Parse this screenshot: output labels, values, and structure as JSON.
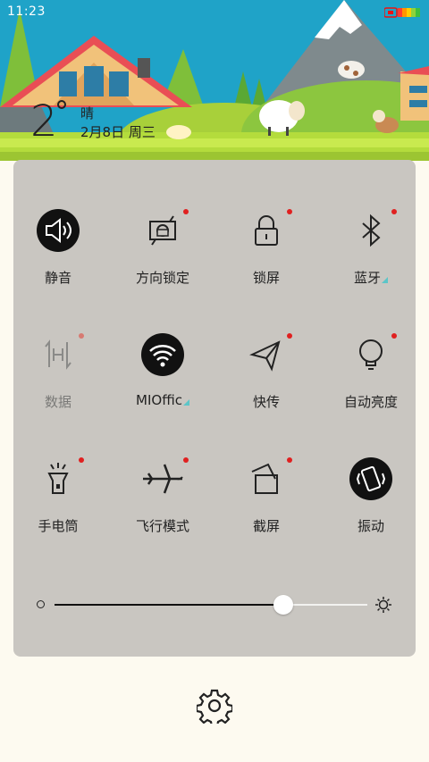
{
  "status_bar": {
    "time": "11:23"
  },
  "weather": {
    "temperature": "2",
    "condition": "晴",
    "date": "2月8日 周三"
  },
  "toggles": [
    {
      "id": "mute",
      "label": "静音",
      "icon": "speaker-icon",
      "active": true,
      "dot": false
    },
    {
      "id": "rotation-lock",
      "label": "方向锁定",
      "icon": "rotation-lock-icon",
      "active": false,
      "dot": true
    },
    {
      "id": "lock-screen",
      "label": "锁屏",
      "icon": "padlock-icon",
      "active": false,
      "dot": true
    },
    {
      "id": "bluetooth",
      "label": "蓝牙",
      "icon": "bluetooth-icon",
      "active": false,
      "dot": true,
      "more": true
    },
    {
      "id": "data",
      "label": "数据",
      "icon": "mobile-data-icon",
      "active": false,
      "dot": true,
      "disabled": true
    },
    {
      "id": "wifi",
      "label": "MIOffic",
      "icon": "wifi-icon",
      "active": true,
      "dot": false,
      "more": true
    },
    {
      "id": "quick-send",
      "label": "快传",
      "icon": "paper-plane-icon",
      "active": false,
      "dot": true
    },
    {
      "id": "auto-brightness",
      "label": "自动亮度",
      "icon": "light-bulb-icon",
      "active": false,
      "dot": true
    },
    {
      "id": "flashlight",
      "label": "手电筒",
      "icon": "flashlight-icon",
      "active": false,
      "dot": true
    },
    {
      "id": "airplane",
      "label": "飞行模式",
      "icon": "airplane-icon",
      "active": false,
      "dot": true
    },
    {
      "id": "screenshot",
      "label": "截屏",
      "icon": "screenshot-icon",
      "active": false,
      "dot": true
    },
    {
      "id": "vibrate",
      "label": "振动",
      "icon": "vibrate-icon",
      "active": true,
      "dot": false
    }
  ],
  "brightness": {
    "level": 0.73,
    "min_icon": "brightness-low-icon",
    "max_icon": "brightness-high-icon"
  },
  "footer": {
    "settings_icon": "gear-icon"
  },
  "colors": {
    "panel": "#c9c6c1",
    "page": "#fdfaf0",
    "accent_dot": "#e02020",
    "more_triangle": "#5cc5c8",
    "sky": "#1fa3c8",
    "grass": "#b4dc3c"
  }
}
